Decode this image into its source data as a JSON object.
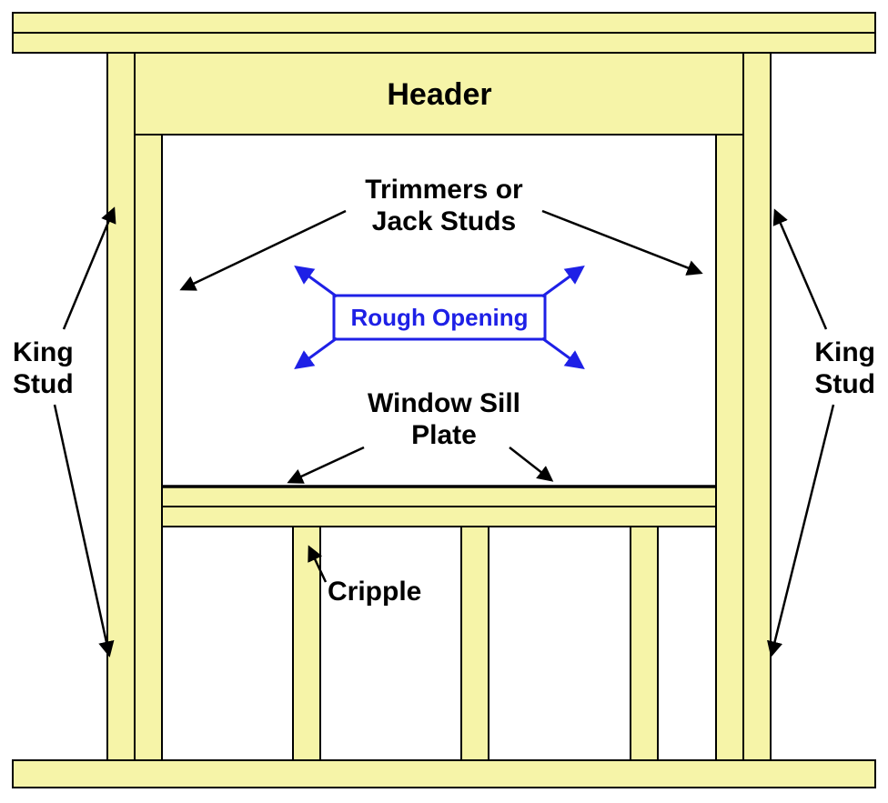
{
  "labels": {
    "header": "Header",
    "trimmers_line1": "Trimmers or",
    "trimmers_line2": "Jack Studs",
    "rough_opening": "Rough Opening",
    "sill_line1": "Window Sill",
    "sill_line2": "Plate",
    "cripple": "Cripple",
    "king_left_line1": "King",
    "king_left_line2": "Stud",
    "king_right_line1": "King",
    "king_right_line2": "Stud"
  },
  "colors": {
    "wood": "#f6f4a8",
    "outline": "#000000",
    "highlight": "#1e20e6"
  }
}
